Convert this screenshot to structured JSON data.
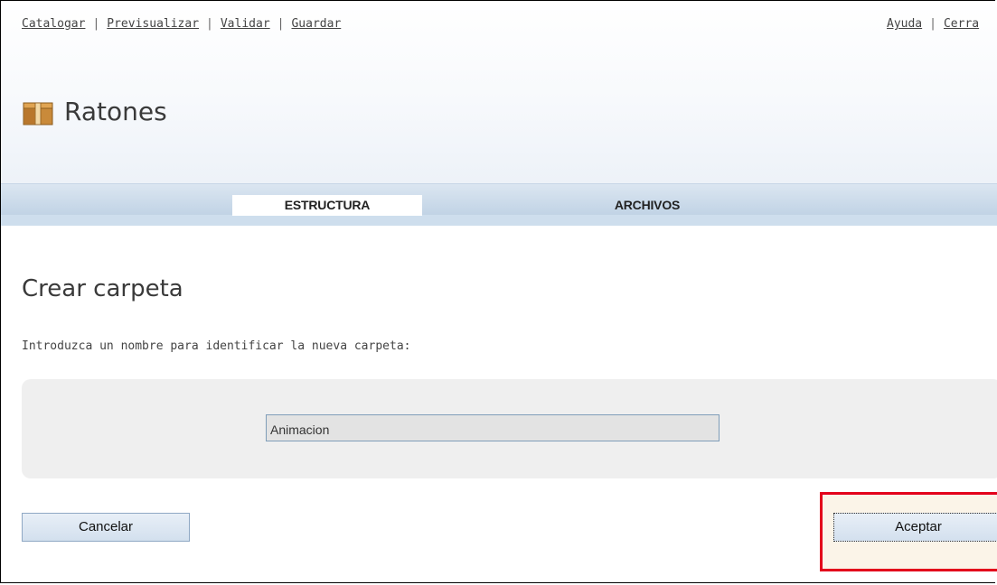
{
  "toolbar": {
    "catalogar": "Catalogar",
    "previsualizar": "Previsualizar",
    "validar": "Validar",
    "guardar": "Guardar",
    "ayuda": "Ayuda",
    "cerrar": "Cerra",
    "separator": "|"
  },
  "header": {
    "title": "Ratones",
    "icon": "box-icon"
  },
  "tabs": [
    {
      "label": "ESTRUCTURA",
      "active": true
    },
    {
      "label": "ARCHIVOS",
      "active": false
    }
  ],
  "main": {
    "section_title": "Crear carpeta",
    "instruction": "Introduzca un nombre para identificar la nueva carpeta:",
    "folder_name_value": "Animacion"
  },
  "buttons": {
    "cancel": "Cancelar",
    "accept": "Aceptar"
  },
  "colors": {
    "highlight": "#e3001b",
    "tab_bar": "#c9d9e9",
    "button_fill": "#d3e0ee"
  }
}
